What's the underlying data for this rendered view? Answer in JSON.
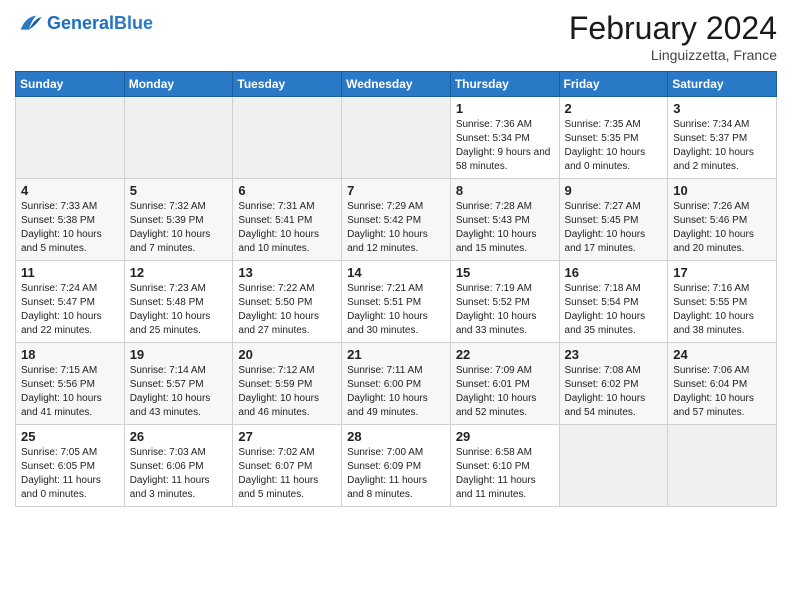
{
  "header": {
    "logo_text_general": "General",
    "logo_text_blue": "Blue",
    "month_title": "February 2024",
    "location": "Linguizzetta, France"
  },
  "weekdays": [
    "Sunday",
    "Monday",
    "Tuesday",
    "Wednesday",
    "Thursday",
    "Friday",
    "Saturday"
  ],
  "weeks": [
    [
      {
        "day": "",
        "info": ""
      },
      {
        "day": "",
        "info": ""
      },
      {
        "day": "",
        "info": ""
      },
      {
        "day": "",
        "info": ""
      },
      {
        "day": "1",
        "info": "Sunrise: 7:36 AM\nSunset: 5:34 PM\nDaylight: 9 hours and 58 minutes."
      },
      {
        "day": "2",
        "info": "Sunrise: 7:35 AM\nSunset: 5:35 PM\nDaylight: 10 hours and 0 minutes."
      },
      {
        "day": "3",
        "info": "Sunrise: 7:34 AM\nSunset: 5:37 PM\nDaylight: 10 hours and 2 minutes."
      }
    ],
    [
      {
        "day": "4",
        "info": "Sunrise: 7:33 AM\nSunset: 5:38 PM\nDaylight: 10 hours and 5 minutes."
      },
      {
        "day": "5",
        "info": "Sunrise: 7:32 AM\nSunset: 5:39 PM\nDaylight: 10 hours and 7 minutes."
      },
      {
        "day": "6",
        "info": "Sunrise: 7:31 AM\nSunset: 5:41 PM\nDaylight: 10 hours and 10 minutes."
      },
      {
        "day": "7",
        "info": "Sunrise: 7:29 AM\nSunset: 5:42 PM\nDaylight: 10 hours and 12 minutes."
      },
      {
        "day": "8",
        "info": "Sunrise: 7:28 AM\nSunset: 5:43 PM\nDaylight: 10 hours and 15 minutes."
      },
      {
        "day": "9",
        "info": "Sunrise: 7:27 AM\nSunset: 5:45 PM\nDaylight: 10 hours and 17 minutes."
      },
      {
        "day": "10",
        "info": "Sunrise: 7:26 AM\nSunset: 5:46 PM\nDaylight: 10 hours and 20 minutes."
      }
    ],
    [
      {
        "day": "11",
        "info": "Sunrise: 7:24 AM\nSunset: 5:47 PM\nDaylight: 10 hours and 22 minutes."
      },
      {
        "day": "12",
        "info": "Sunrise: 7:23 AM\nSunset: 5:48 PM\nDaylight: 10 hours and 25 minutes."
      },
      {
        "day": "13",
        "info": "Sunrise: 7:22 AM\nSunset: 5:50 PM\nDaylight: 10 hours and 27 minutes."
      },
      {
        "day": "14",
        "info": "Sunrise: 7:21 AM\nSunset: 5:51 PM\nDaylight: 10 hours and 30 minutes."
      },
      {
        "day": "15",
        "info": "Sunrise: 7:19 AM\nSunset: 5:52 PM\nDaylight: 10 hours and 33 minutes."
      },
      {
        "day": "16",
        "info": "Sunrise: 7:18 AM\nSunset: 5:54 PM\nDaylight: 10 hours and 35 minutes."
      },
      {
        "day": "17",
        "info": "Sunrise: 7:16 AM\nSunset: 5:55 PM\nDaylight: 10 hours and 38 minutes."
      }
    ],
    [
      {
        "day": "18",
        "info": "Sunrise: 7:15 AM\nSunset: 5:56 PM\nDaylight: 10 hours and 41 minutes."
      },
      {
        "day": "19",
        "info": "Sunrise: 7:14 AM\nSunset: 5:57 PM\nDaylight: 10 hours and 43 minutes."
      },
      {
        "day": "20",
        "info": "Sunrise: 7:12 AM\nSunset: 5:59 PM\nDaylight: 10 hours and 46 minutes."
      },
      {
        "day": "21",
        "info": "Sunrise: 7:11 AM\nSunset: 6:00 PM\nDaylight: 10 hours and 49 minutes."
      },
      {
        "day": "22",
        "info": "Sunrise: 7:09 AM\nSunset: 6:01 PM\nDaylight: 10 hours and 52 minutes."
      },
      {
        "day": "23",
        "info": "Sunrise: 7:08 AM\nSunset: 6:02 PM\nDaylight: 10 hours and 54 minutes."
      },
      {
        "day": "24",
        "info": "Sunrise: 7:06 AM\nSunset: 6:04 PM\nDaylight: 10 hours and 57 minutes."
      }
    ],
    [
      {
        "day": "25",
        "info": "Sunrise: 7:05 AM\nSunset: 6:05 PM\nDaylight: 11 hours and 0 minutes."
      },
      {
        "day": "26",
        "info": "Sunrise: 7:03 AM\nSunset: 6:06 PM\nDaylight: 11 hours and 3 minutes."
      },
      {
        "day": "27",
        "info": "Sunrise: 7:02 AM\nSunset: 6:07 PM\nDaylight: 11 hours and 5 minutes."
      },
      {
        "day": "28",
        "info": "Sunrise: 7:00 AM\nSunset: 6:09 PM\nDaylight: 11 hours and 8 minutes."
      },
      {
        "day": "29",
        "info": "Sunrise: 6:58 AM\nSunset: 6:10 PM\nDaylight: 11 hours and 11 minutes."
      },
      {
        "day": "",
        "info": ""
      },
      {
        "day": "",
        "info": ""
      }
    ]
  ]
}
